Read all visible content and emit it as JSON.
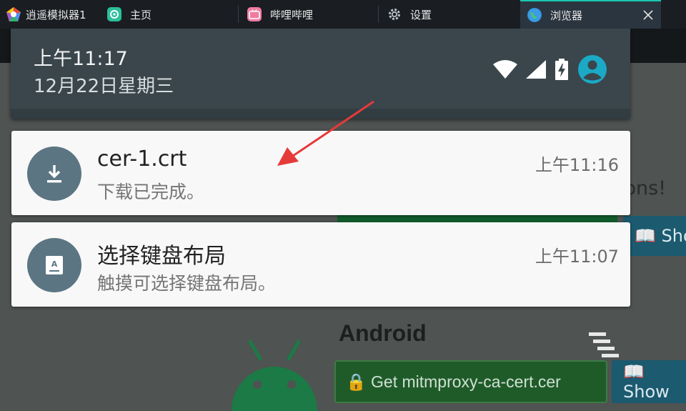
{
  "tabs": [
    {
      "label": "逍遥模拟器1",
      "icon": "memu-logo-icon"
    },
    {
      "label": "主页",
      "icon": "home-app-icon"
    },
    {
      "label": "哔哩哔哩",
      "icon": "bilibili-icon"
    },
    {
      "label": "设置",
      "icon": "gear-icon"
    },
    {
      "label": "浏览器",
      "icon": "globe-icon",
      "active": true
    }
  ],
  "status": {
    "time": "上午11:17",
    "date": "12月22日星期三"
  },
  "notifications": [
    {
      "title": "cer-1.crt",
      "text": "下载已完成。",
      "time": "上午11:16",
      "icon": "download-icon"
    },
    {
      "title": "选择键盘布局",
      "text": "触摸可选择键盘布局。",
      "time": "上午11:07",
      "icon": "keyboard-icon"
    }
  ],
  "background_page": {
    "partial_text": "ions!",
    "show_button_1": "📖 Sho",
    "heading": "Android",
    "get_cert_button": "🔒 Get mitmproxy-ca-cert.cer",
    "show_button_2": "📖 Show"
  },
  "colors": {
    "accent_arrow": "#e63a3a",
    "notif_icon_bg": "#5c7583",
    "qs_bg": "#3a464c",
    "avatar": "#1ba9c6"
  }
}
